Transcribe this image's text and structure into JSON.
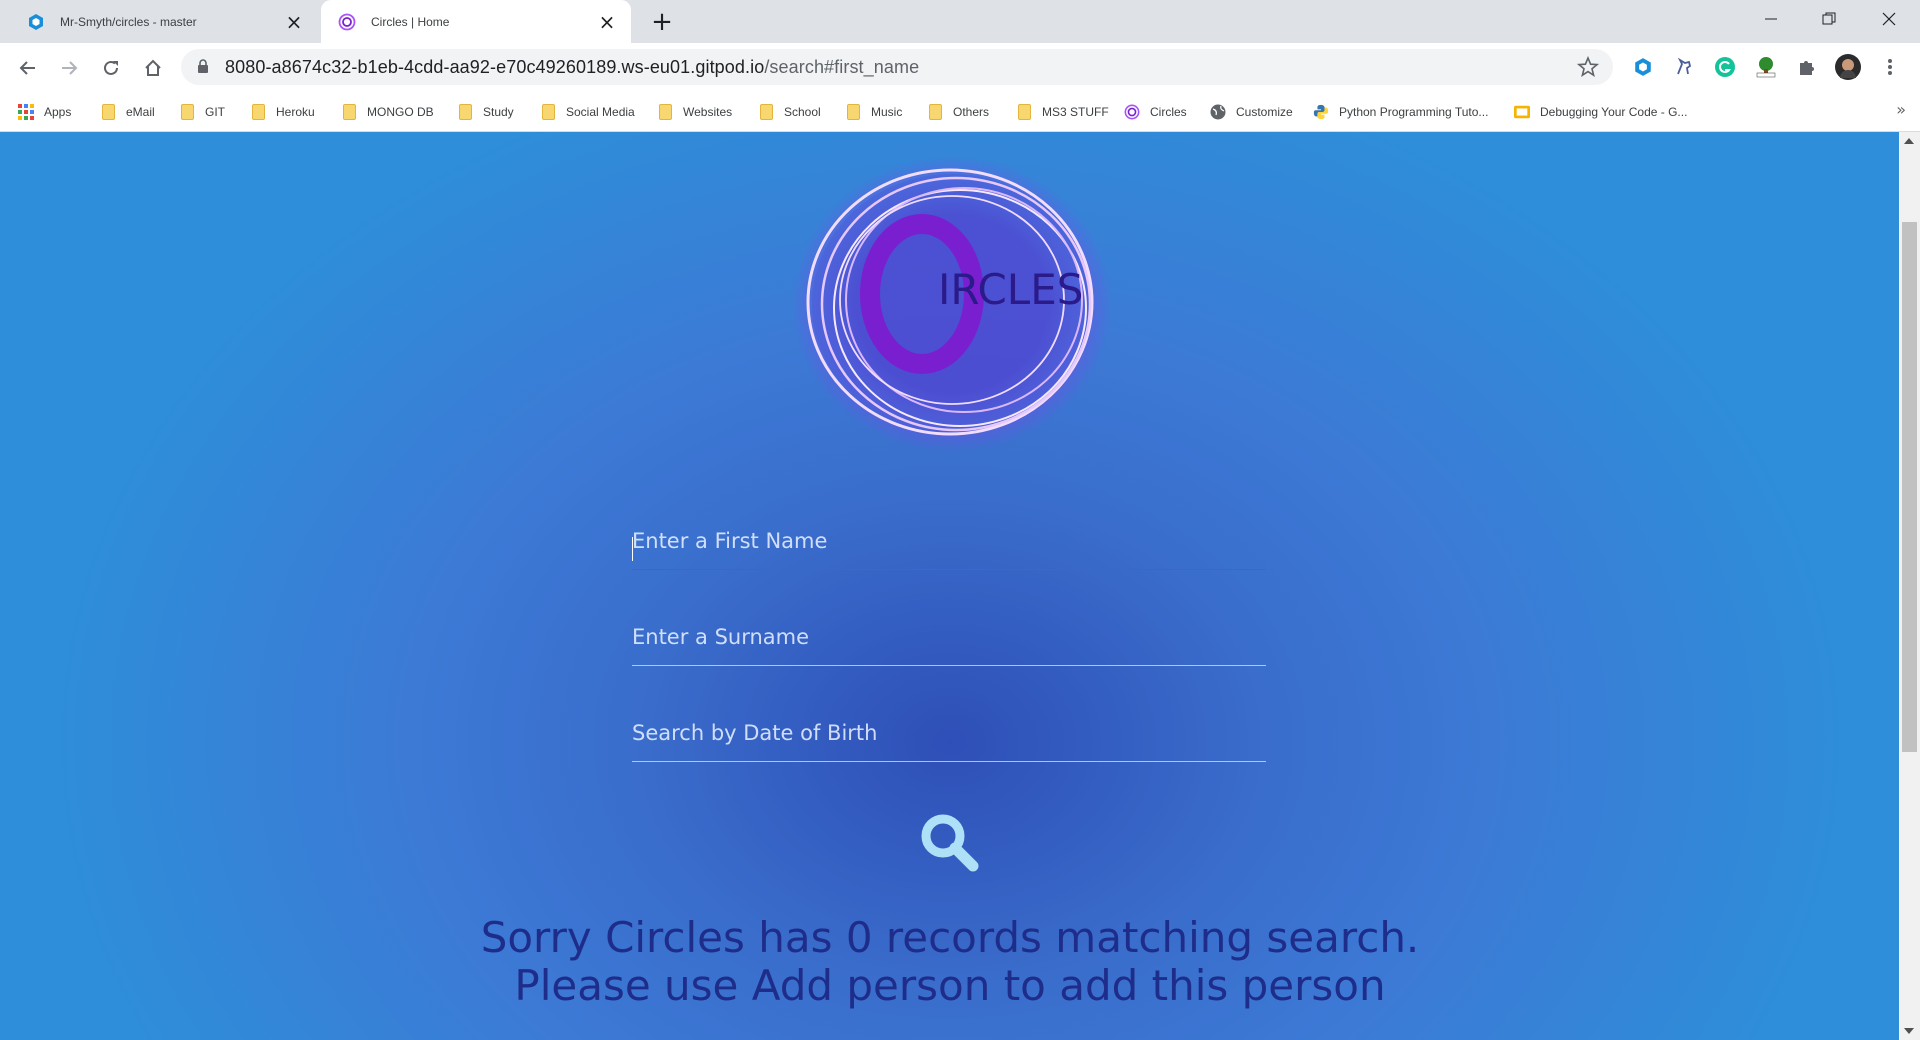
{
  "browser": {
    "tabs": [
      {
        "title": "Mr-Smyth/circles - master",
        "icon": "gitpod-icon",
        "active": false
      },
      {
        "title": "Circles | Home",
        "icon": "circles-favicon-icon",
        "active": true
      }
    ],
    "url_host": "8080-a8674c32-b1eb-4cdd-aa92-e70c49260189.ws-eu01.gitpod.io",
    "url_path": "/search#first_name",
    "bookmarks": [
      {
        "label": "Apps",
        "icon": "apps-grid-icon"
      },
      {
        "label": "eMail",
        "icon": "folder-icon"
      },
      {
        "label": "GIT",
        "icon": "folder-icon"
      },
      {
        "label": "Heroku",
        "icon": "folder-icon"
      },
      {
        "label": "MONGO DB",
        "icon": "folder-icon"
      },
      {
        "label": "Study",
        "icon": "folder-icon"
      },
      {
        "label": "Social Media",
        "icon": "folder-icon"
      },
      {
        "label": "Websites",
        "icon": "folder-icon"
      },
      {
        "label": "School",
        "icon": "folder-icon"
      },
      {
        "label": "Music",
        "icon": "folder-icon"
      },
      {
        "label": "Others",
        "icon": "folder-icon"
      },
      {
        "label": "MS3 STUFF",
        "icon": "folder-icon"
      },
      {
        "label": "Circles",
        "icon": "circles-favicon-icon"
      },
      {
        "label": "Customize",
        "icon": "globe-icon"
      },
      {
        "label": "Python Programming Tuto...",
        "icon": "python-icon"
      },
      {
        "label": "Debugging Your Code - G...",
        "icon": "slides-icon"
      }
    ],
    "more_bookmarks": "»"
  },
  "page": {
    "logo_text": "IRCLES",
    "search_form": {
      "first_name_placeholder": "Enter a First Name",
      "surname_placeholder": "Enter a Surname",
      "dob_placeholder": "Search by Date of Birth"
    },
    "message_line1": "Sorry Circles has 0 records matching search.",
    "message_line2": "Please use Add person to add this person"
  },
  "colors": {
    "page_blue": "#3a6dcc",
    "message_text": "#1f2d8a",
    "logo_purple": "#7a1fd0"
  }
}
